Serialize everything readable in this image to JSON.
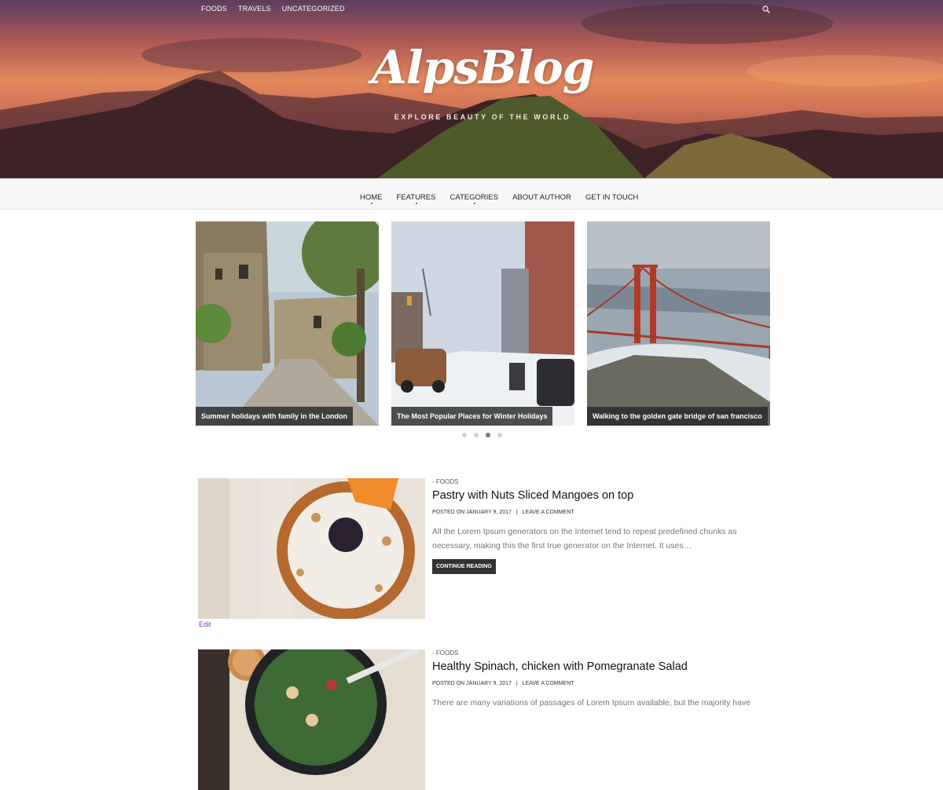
{
  "top_nav": {
    "items": [
      "FOODS",
      "TRAVELS",
      "UNCATEGORIZED"
    ]
  },
  "site": {
    "title": "AlpsBlog",
    "tagline": "EXPLORE BEAUTY OF THE WORLD"
  },
  "main_nav": {
    "items": [
      "HOME",
      "FEATURES",
      "CATEGORIES",
      "ABOUT AUTHOR",
      "GET IN TOUCH"
    ]
  },
  "slider": {
    "slides": [
      {
        "caption": "Summer holidays with family in the London"
      },
      {
        "caption": "The Most Popular Places for Winter Holidays"
      },
      {
        "caption": "Walking to the golden gate bridge of san francisco"
      }
    ],
    "active_dot": 3,
    "dot_count": 4
  },
  "posts": [
    {
      "category": "- FOODS",
      "title": "Pastry with Nuts Sliced Mangoes on top",
      "posted_on_label": "POSTED ON",
      "date": "JANUARY 9, 2017",
      "comment_link": "LEAVE A COMMENT",
      "excerpt": "All the Lorem Ipsum generators on the Internet tend to repeat predefined chunks as necessary, making this the first true generator on the Internet. It uses…",
      "button": "CONTINUE READING",
      "edit": "Edit"
    },
    {
      "category": "- FOODS",
      "title": "Healthy Spinach, chicken with Pomegranate Salad",
      "posted_on_label": "POSTED ON",
      "date": "JANUARY 9, 2017",
      "comment_link": "LEAVE A COMMENT",
      "excerpt": "There are many variations of passages of Lorem Ipsum available, but the majority have"
    }
  ],
  "icons": {
    "search": "search-icon"
  }
}
